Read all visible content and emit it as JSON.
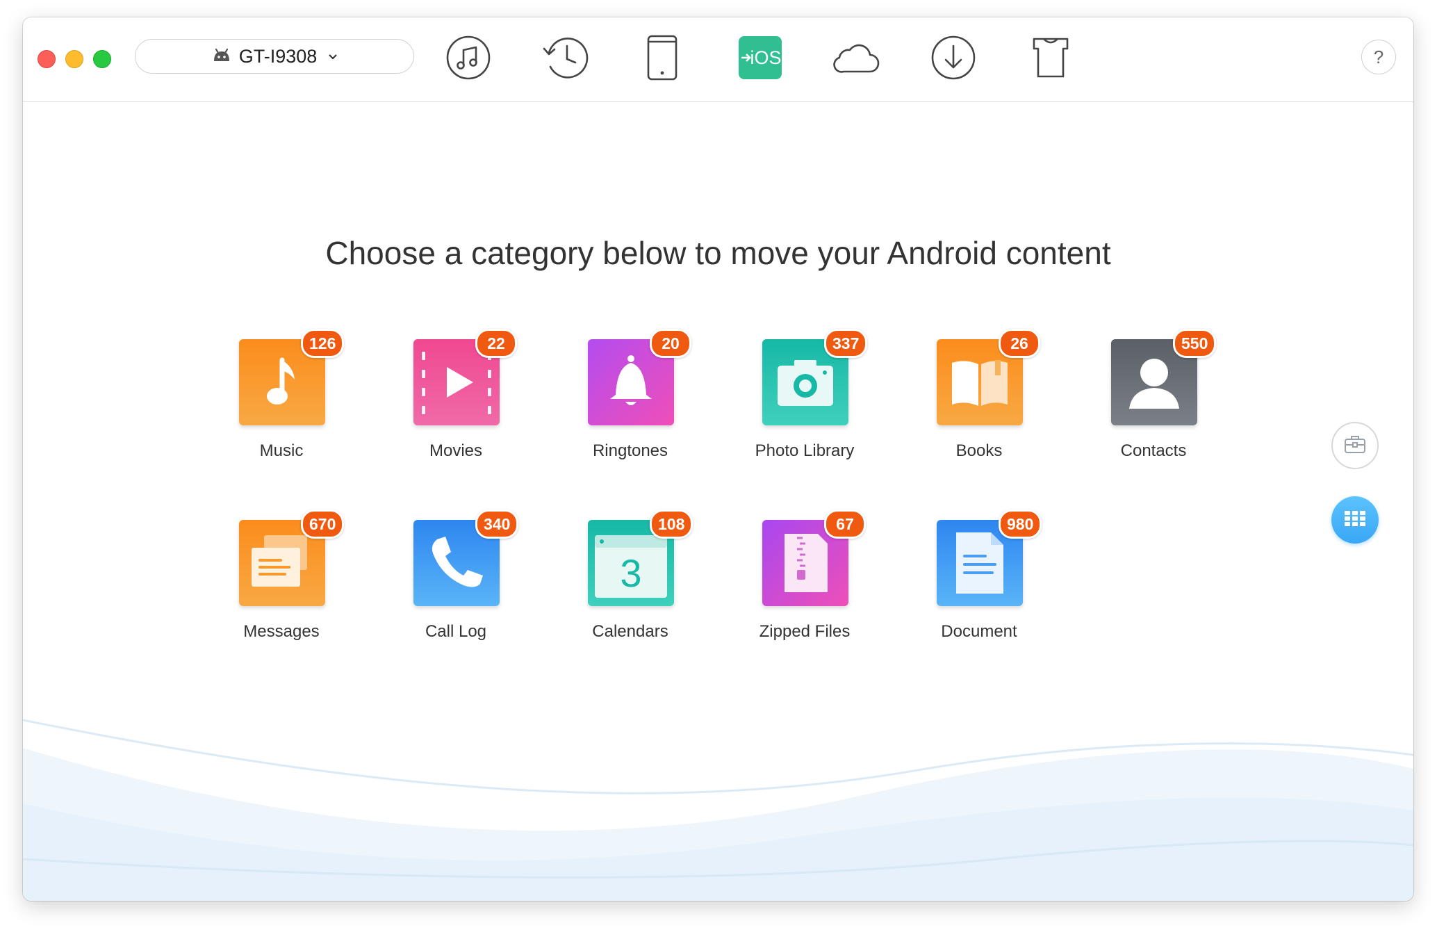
{
  "titlebar": {
    "device_name": "GT-I9308",
    "help_label": "?",
    "toolbar": [
      {
        "name": "music-manager-icon"
      },
      {
        "name": "backup-history-icon"
      },
      {
        "name": "device-manager-icon"
      },
      {
        "name": "android-to-ios-icon",
        "label": "iOS",
        "active": true
      },
      {
        "name": "icloud-manager-icon"
      },
      {
        "name": "download-icon"
      },
      {
        "name": "theme-icon"
      }
    ]
  },
  "main": {
    "heading": "Choose a category below to move your Android content",
    "categories": [
      {
        "label": "Music",
        "count": "126",
        "icon": "music-note-icon",
        "color_from": "#fb8c1c",
        "color_to": "#f8a944"
      },
      {
        "label": "Movies",
        "count": "22",
        "icon": "film-play-icon",
        "color_from": "#f04891",
        "color_to": "#f06aa8"
      },
      {
        "label": "Ringtones",
        "count": "20",
        "icon": "bell-icon",
        "color_from": "#b44cf0",
        "color_to": "#ef4fb8"
      },
      {
        "label": "Photo Library",
        "count": "337",
        "icon": "camera-icon",
        "color_from": "#17b8a6",
        "color_to": "#3fd0bc"
      },
      {
        "label": "Books",
        "count": "26",
        "icon": "open-book-icon",
        "color_from": "#fb8c1c",
        "color_to": "#f8a944"
      },
      {
        "label": "Contacts",
        "count": "550",
        "icon": "person-icon",
        "color_from": "#5b5f66",
        "color_to": "#7b8088"
      },
      {
        "label": "Messages",
        "count": "670",
        "icon": "message-icon",
        "color_from": "#fb8c1c",
        "color_to": "#f8a944"
      },
      {
        "label": "Call Log",
        "count": "340",
        "icon": "phone-icon",
        "color_from": "#2e86f0",
        "color_to": "#5ab4f7"
      },
      {
        "label": "Calendars",
        "count": "108",
        "icon": "calendar-icon",
        "color_from": "#17b8a6",
        "color_to": "#3fd0bc",
        "day": "3"
      },
      {
        "label": "Zipped Files",
        "count": "67",
        "icon": "zip-file-icon",
        "color_from": "#a847f0",
        "color_to": "#ef4fb8"
      },
      {
        "label": "Document",
        "count": "980",
        "icon": "document-icon",
        "color_from": "#2e86f0",
        "color_to": "#5ab4f7"
      }
    ]
  },
  "colors": {
    "badge": "#ef5a10",
    "accent_green": "#2fbf90",
    "grid_button": "#3aa7f6"
  }
}
